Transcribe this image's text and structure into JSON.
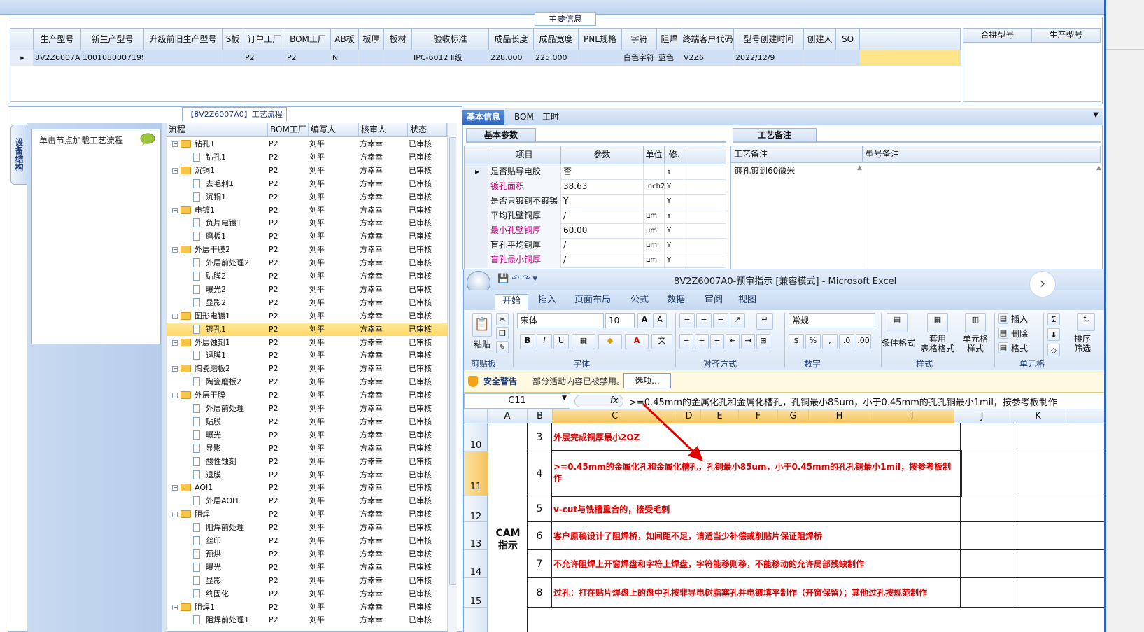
{
  "main_info": {
    "group_title": "主要信息",
    "columns": [
      "生产型号",
      "新生产型号",
      "升级前旧生产型号",
      "S板",
      "订单工厂",
      "BOM工厂",
      "AB板",
      "板厚",
      "板材",
      "验收标准",
      "成品长度",
      "成品宽度",
      "PNL规格",
      "字符",
      "阻焊",
      "终端客户代码",
      "型号创建时间",
      "创建人",
      "SO"
    ],
    "row": [
      "8V2Z6007A0",
      "10010800071996",
      "",
      "",
      "P2",
      "P2",
      "N",
      "",
      "",
      "IPC-6012 Ⅱ级",
      "228.000",
      "225.000",
      "",
      "白色字符",
      "蓝色",
      "V2Z6",
      "2022/12/9",
      "",
      ""
    ],
    "merge_columns": [
      "合拼型号",
      "生产型号"
    ]
  },
  "process_tree": {
    "title": "【8V2Z6007A0】工艺流程",
    "side_tab": "设备结构",
    "load_hint": "单击节点加载工艺流程",
    "columns": [
      "流程",
      "BOM工厂",
      "编写人",
      "核审人",
      "状态"
    ],
    "rows": [
      {
        "name": "钻孔1",
        "level": 0,
        "factory": "P2",
        "writer": "刘平",
        "reviewer": "方幸幸",
        "status": "已审核"
      },
      {
        "name": "钻孔1",
        "level": 1,
        "factory": "P2",
        "writer": "刘平",
        "reviewer": "方幸幸",
        "status": "已审核"
      },
      {
        "name": "沉铜1",
        "level": 0,
        "factory": "P2",
        "writer": "刘平",
        "reviewer": "方幸幸",
        "status": "已审核"
      },
      {
        "name": "去毛刺1",
        "level": 1,
        "factory": "P2",
        "writer": "刘平",
        "reviewer": "方幸幸",
        "status": "已审核"
      },
      {
        "name": "沉铜1",
        "level": 1,
        "factory": "P2",
        "writer": "刘平",
        "reviewer": "方幸幸",
        "status": "已审核"
      },
      {
        "name": "电镀1",
        "level": 0,
        "factory": "P2",
        "writer": "刘平",
        "reviewer": "方幸幸",
        "status": "已审核"
      },
      {
        "name": "负片电镀1",
        "level": 1,
        "factory": "P2",
        "writer": "刘平",
        "reviewer": "方幸幸",
        "status": "已审核"
      },
      {
        "name": "磨板1",
        "level": 1,
        "factory": "P2",
        "writer": "刘平",
        "reviewer": "方幸幸",
        "status": "已审核"
      },
      {
        "name": "外层干膜2",
        "level": 0,
        "factory": "P2",
        "writer": "刘平",
        "reviewer": "方幸幸",
        "status": "已审核"
      },
      {
        "name": "外层前处理2",
        "level": 1,
        "factory": "P2",
        "writer": "刘平",
        "reviewer": "方幸幸",
        "status": "已审核"
      },
      {
        "name": "贴膜2",
        "level": 1,
        "factory": "P2",
        "writer": "刘平",
        "reviewer": "方幸幸",
        "status": "已审核"
      },
      {
        "name": "曝光2",
        "level": 1,
        "factory": "P2",
        "writer": "刘平",
        "reviewer": "方幸幸",
        "status": "已审核"
      },
      {
        "name": "显影2",
        "level": 1,
        "factory": "P2",
        "writer": "刘平",
        "reviewer": "方幸幸",
        "status": "已审核"
      },
      {
        "name": "图形电镀1",
        "level": 0,
        "factory": "P2",
        "writer": "刘平",
        "reviewer": "方幸幸",
        "status": "已审核"
      },
      {
        "name": "镀孔1",
        "level": 1,
        "factory": "P2",
        "writer": "刘平",
        "reviewer": "方幸幸",
        "status": "已审核",
        "selected": true
      },
      {
        "name": "外层蚀刻1",
        "level": 0,
        "factory": "P2",
        "writer": "刘平",
        "reviewer": "方幸幸",
        "status": "已审核"
      },
      {
        "name": "退膜1",
        "level": 1,
        "factory": "P2",
        "writer": "刘平",
        "reviewer": "方幸幸",
        "status": "已审核"
      },
      {
        "name": "陶瓷磨板2",
        "level": 0,
        "factory": "P2",
        "writer": "刘平",
        "reviewer": "方幸幸",
        "status": "已审核"
      },
      {
        "name": "陶瓷磨板2",
        "level": 1,
        "factory": "P2",
        "writer": "刘平",
        "reviewer": "方幸幸",
        "status": "已审核"
      },
      {
        "name": "外层干膜",
        "level": 0,
        "factory": "P2",
        "writer": "刘平",
        "reviewer": "方幸幸",
        "status": "已审核"
      },
      {
        "name": "外层前处理",
        "level": 1,
        "factory": "P2",
        "writer": "刘平",
        "reviewer": "方幸幸",
        "status": "已审核"
      },
      {
        "name": "贴膜",
        "level": 1,
        "factory": "P2",
        "writer": "刘平",
        "reviewer": "方幸幸",
        "status": "已审核"
      },
      {
        "name": "曝光",
        "level": 1,
        "factory": "P2",
        "writer": "刘平",
        "reviewer": "方幸幸",
        "status": "已审核"
      },
      {
        "name": "显影",
        "level": 1,
        "factory": "P2",
        "writer": "刘平",
        "reviewer": "方幸幸",
        "status": "已审核"
      },
      {
        "name": "酸性蚀刻",
        "level": 1,
        "factory": "P2",
        "writer": "刘平",
        "reviewer": "方幸幸",
        "status": "已审核"
      },
      {
        "name": "退膜",
        "level": 1,
        "factory": "P2",
        "writer": "刘平",
        "reviewer": "方幸幸",
        "status": "已审核"
      },
      {
        "name": "AOI1",
        "level": 0,
        "factory": "P2",
        "writer": "刘平",
        "reviewer": "方幸幸",
        "status": "已审核"
      },
      {
        "name": "外层AOI1",
        "level": 1,
        "factory": "P2",
        "writer": "刘平",
        "reviewer": "方幸幸",
        "status": "已审核"
      },
      {
        "name": "阻焊",
        "level": 0,
        "factory": "P2",
        "writer": "刘平",
        "reviewer": "方幸幸",
        "status": "已审核"
      },
      {
        "name": "阻焊前处理",
        "level": 1,
        "factory": "P2",
        "writer": "刘平",
        "reviewer": "方幸幸",
        "status": "已审核"
      },
      {
        "name": "丝印",
        "level": 1,
        "factory": "P2",
        "writer": "刘平",
        "reviewer": "方幸幸",
        "status": "已审核"
      },
      {
        "name": "预烘",
        "level": 1,
        "factory": "P2",
        "writer": "刘平",
        "reviewer": "方幸幸",
        "status": "已审核"
      },
      {
        "name": "曝光",
        "level": 1,
        "factory": "P2",
        "writer": "刘平",
        "reviewer": "方幸幸",
        "status": "已审核"
      },
      {
        "name": "显影",
        "level": 1,
        "factory": "P2",
        "writer": "刘平",
        "reviewer": "方幸幸",
        "status": "已审核"
      },
      {
        "name": "终固化",
        "level": 1,
        "factory": "P2",
        "writer": "刘平",
        "reviewer": "方幸幸",
        "status": "已审核"
      },
      {
        "name": "阻焊1",
        "level": 0,
        "factory": "P2",
        "writer": "刘平",
        "reviewer": "方幸幸",
        "status": "已审核"
      },
      {
        "name": "阻焊前处理1",
        "level": 1,
        "factory": "P2",
        "writer": "刘平",
        "reviewer": "方幸幸",
        "status": "已审核"
      }
    ]
  },
  "basic_info": {
    "tabs": [
      "基本信息",
      "BOM",
      "工时"
    ],
    "params_title": "基本参数",
    "notes_title": "工艺备注",
    "param_columns": [
      "项目",
      "参数",
      "单位",
      "修."
    ],
    "params": [
      {
        "item": "是否贴导电胶",
        "value": "否",
        "unit": "",
        "flag": "Y",
        "highlight": false
      },
      {
        "item": "镀孔面积",
        "value": "38.63",
        "unit": "inch2",
        "flag": "Y",
        "highlight": true
      },
      {
        "item": "是否只镀铜不镀锡",
        "value": "Y",
        "unit": "",
        "flag": "Y",
        "highlight": false
      },
      {
        "item": "平均孔壁铜厚",
        "value": "/",
        "unit": "μm",
        "flag": "Y",
        "highlight": false
      },
      {
        "item": "最小孔壁铜厚",
        "value": "60.00",
        "unit": "μm",
        "flag": "Y",
        "highlight": true
      },
      {
        "item": "盲孔平均铜厚",
        "value": "/",
        "unit": "μm",
        "flag": "Y",
        "highlight": false
      },
      {
        "item": "盲孔最小铜厚",
        "value": "/",
        "unit": "μm",
        "flag": "Y",
        "highlight": true
      }
    ],
    "notes_columns": [
      "工艺备注",
      "型号备注"
    ],
    "process_note": "镀孔镀到60微米",
    "model_note": ""
  },
  "excel": {
    "title": "8V2Z6007A0-预审指示  [兼容模式] - Microsoft Excel",
    "ribbon_tabs": [
      "开始",
      "插入",
      "页面布局",
      "公式",
      "数据",
      "审阅",
      "视图"
    ],
    "font_name": "宋体",
    "font_size": "10",
    "number_format": "常规",
    "group_labels": [
      "剪贴板",
      "字体",
      "对齐方式",
      "数字",
      "样式",
      "单元格"
    ],
    "buttons": {
      "paste": "粘贴",
      "cond_format": "条件格式",
      "table_format": "套用\n表格格式",
      "cell_style": "单元格\n样式",
      "insert": "插入",
      "delete": "删除",
      "format": "格式",
      "sort": "排序\n筛选"
    },
    "security_label": "安全警告",
    "security_text": "部分活动内容已被禁用。",
    "options_button": "选项...",
    "cell_ref": "C11",
    "formula": ">=0.45mm的金属化孔和金属化槽孔，孔铜最小85um，小于0.45mm的孔孔铜最小1mil，按参考板制作",
    "columns": [
      "A",
      "B",
      "C",
      "D",
      "E",
      "F",
      "G",
      "H",
      "I",
      "J",
      "K"
    ],
    "cam_label": "CAM\n指示",
    "rows": [
      {
        "rownum": "10",
        "no": "3",
        "text": "外层完成铜厚最小2OZ"
      },
      {
        "rownum": "11",
        "no": "4",
        "text": ">=0.45mm的金属化孔和金属化槽孔，孔铜最小85um，小于0.45mm的孔孔铜最小1mil，按参考板制作"
      },
      {
        "rownum": "12",
        "no": "5",
        "text": "v-cut与铣槽重合的，接受毛刺"
      },
      {
        "rownum": "13",
        "no": "6",
        "text": "客户原稿设计了阻焊桥，如间距不足，请适当少补偿或削贴片保证阻焊桥"
      },
      {
        "rownum": "14",
        "no": "7",
        "text": "不允许阻焊上开窗焊盘和字符上焊盘，字符能移则移，不能移动的允许局部残缺制作"
      },
      {
        "rownum": "15",
        "no": "8",
        "text": "过孔：打在贴片焊盘上的盘中孔按非导电树脂塞孔并电镀填平制作（开窗保留）；其他过孔按规范制作"
      }
    ]
  },
  "colors": {
    "accent": "#2f66bc",
    "selection": "#ffd866",
    "red_text": "#e00000",
    "arrow": "#e00000"
  }
}
